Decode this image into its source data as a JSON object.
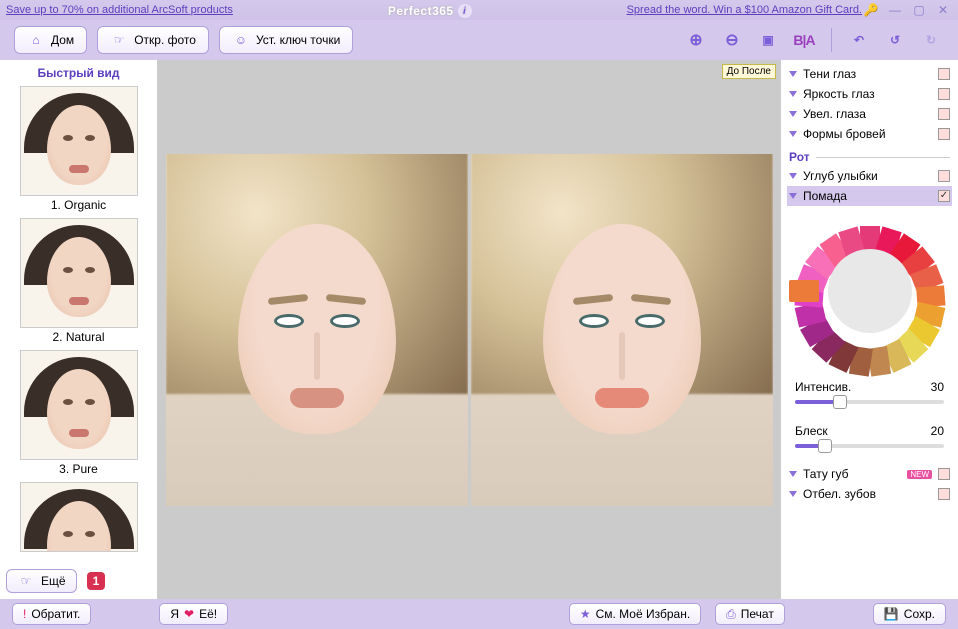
{
  "titlebar": {
    "promo_left": "Save up to 70% on additional ArcSoft products",
    "app_name": "Perfect365",
    "promo_right": "Spread the word. Win a $100 Amazon Gift Card."
  },
  "toolbar": {
    "home": "Дом",
    "open": "Откр. фото",
    "keypoints": "Уст. ключ точки",
    "bia": "B|A"
  },
  "sidebar": {
    "title": "Быстрый вид",
    "presets": [
      {
        "label": "1. Organic"
      },
      {
        "label": "2. Natural"
      },
      {
        "label": "3. Pure"
      }
    ],
    "more_label": "Ещё",
    "more_count": "1"
  },
  "canvas": {
    "tooltip": "До После"
  },
  "panel": {
    "items_top": [
      {
        "label": "Тени глаз"
      },
      {
        "label": "Яркость глаз"
      },
      {
        "label": "Увел. глаза"
      },
      {
        "label": "Формы бровей"
      }
    ],
    "category": "Рот",
    "items_mouth": [
      {
        "label": "Углуб улыбки",
        "active": false
      },
      {
        "label": "Помада",
        "active": true
      }
    ],
    "slider1": {
      "label": "Интенсив.",
      "value": "30"
    },
    "slider2": {
      "label": "Блеск",
      "value": "20"
    },
    "items_bottom": [
      {
        "label": "Тату губ",
        "new": "NEW"
      },
      {
        "label": "Отбел. зубов"
      }
    ],
    "colors": [
      "#E43A78",
      "#E8185A",
      "#E8183A",
      "#E84040",
      "#E86048",
      "#EC7A38",
      "#ECA030",
      "#ECC830",
      "#E8D858",
      "#D8B858",
      "#C08850",
      "#A06040",
      "#803838",
      "#8A2860",
      "#A02888",
      "#C030A8",
      "#E040C8",
      "#F060C0",
      "#F870B8",
      "#F86090",
      "#EA4A84"
    ],
    "selected_color": "#EC7A38"
  },
  "statusbar": {
    "feedback": "Обратит.",
    "love_pre": "Я",
    "love_post": "Eё!",
    "favorites": "См. Моё Избран.",
    "print": "Печат",
    "save": "Сохр."
  }
}
